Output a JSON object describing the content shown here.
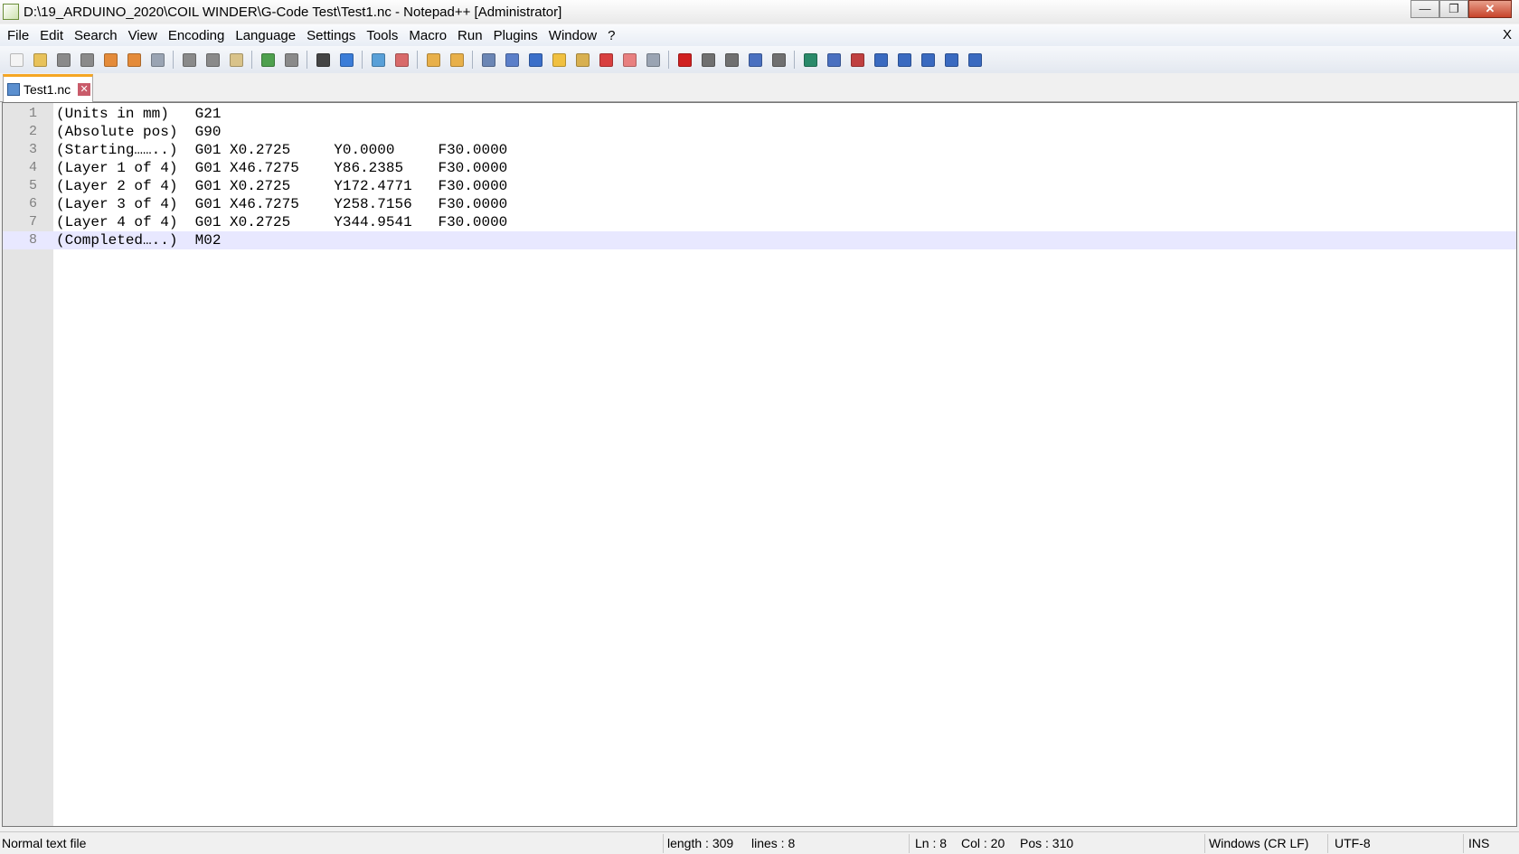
{
  "window": {
    "title": "D:\\19_ARDUINO_2020\\COIL WINDER\\G-Code Test\\Test1.nc - Notepad++ [Administrator]",
    "minimize": "—",
    "maximize": "❐",
    "close": "✕"
  },
  "menu": [
    "File",
    "Edit",
    "Search",
    "View",
    "Encoding",
    "Language",
    "Settings",
    "Tools",
    "Macro",
    "Run",
    "Plugins",
    "Window",
    "?"
  ],
  "menu_close": "X",
  "toolbar": [
    {
      "name": "new-file-icon",
      "color": "#f4f4f4"
    },
    {
      "name": "open-file-icon",
      "color": "#e8c25a"
    },
    {
      "name": "save-icon",
      "color": "#8a8a8a"
    },
    {
      "name": "save-all-icon",
      "color": "#8a8a8a"
    },
    {
      "name": "close-icon",
      "color": "#e48b3a"
    },
    {
      "name": "close-all-icon",
      "color": "#e48b3a"
    },
    {
      "name": "print-icon",
      "color": "#9aa4b3"
    },
    "sep",
    {
      "name": "cut-icon",
      "color": "#8a8a8a"
    },
    {
      "name": "copy-icon",
      "color": "#8a8a8a"
    },
    {
      "name": "paste-icon",
      "color": "#d9c38a"
    },
    "sep",
    {
      "name": "undo-icon",
      "color": "#4ea04e"
    },
    {
      "name": "redo-icon",
      "color": "#8a8a8a"
    },
    "sep",
    {
      "name": "find-icon",
      "color": "#444444"
    },
    {
      "name": "replace-icon",
      "color": "#3b7dd8"
    },
    "sep",
    {
      "name": "zoom-in-icon",
      "color": "#59a0d8"
    },
    {
      "name": "zoom-out-icon",
      "color": "#d86a6a"
    },
    "sep",
    {
      "name": "sync-vertical-icon",
      "color": "#e8b04a"
    },
    {
      "name": "sync-horizontal-icon",
      "color": "#e8b04a"
    },
    "sep",
    {
      "name": "word-wrap-icon",
      "color": "#6b86b5"
    },
    {
      "name": "show-all-chars-icon",
      "color": "#5b7fc9"
    },
    {
      "name": "indent-guide-icon",
      "color": "#3b6fc9"
    },
    {
      "name": "doc-map-icon",
      "color": "#f0c040"
    },
    {
      "name": "function-list-icon",
      "color": "#d8b050"
    },
    {
      "name": "folder-workspace-icon",
      "color": "#d84040"
    },
    {
      "name": "monitor-icon",
      "color": "#e88080"
    },
    {
      "name": "eye-icon",
      "color": "#9aa4b3"
    },
    "sep",
    {
      "name": "record-macro-icon",
      "color": "#d02020"
    },
    {
      "name": "stop-macro-icon",
      "color": "#707070"
    },
    {
      "name": "play-macro-icon",
      "color": "#707070"
    },
    {
      "name": "run-macro-multiple-icon",
      "color": "#4a70c0"
    },
    {
      "name": "save-macro-icon",
      "color": "#707070"
    },
    "sep",
    {
      "name": "compare-icon",
      "color": "#2a8a6a"
    },
    {
      "name": "compare-next-icon",
      "color": "#4a70c0"
    },
    {
      "name": "compare-clear-icon",
      "color": "#c04040"
    },
    {
      "name": "first-diff-icon",
      "color": "#3a6ac0"
    },
    {
      "name": "prev-diff-icon",
      "color": "#3a6ac0"
    },
    {
      "name": "next-diff-icon",
      "color": "#3a6ac0"
    },
    {
      "name": "last-diff-icon",
      "color": "#3a6ac0"
    },
    {
      "name": "compare-panel-icon",
      "color": "#3a6ac0"
    }
  ],
  "tab": {
    "label": "Test1.nc",
    "close": "✕"
  },
  "lines": [
    {
      "n": "1",
      "text": "(Units in mm)   G21"
    },
    {
      "n": "2",
      "text": "(Absolute pos)  G90"
    },
    {
      "n": "3",
      "text": "(Starting……..)  G01 X0.2725     Y0.0000     F30.0000"
    },
    {
      "n": "4",
      "text": "(Layer 1 of 4)  G01 X46.7275    Y86.2385    F30.0000"
    },
    {
      "n": "5",
      "text": "(Layer 2 of 4)  G01 X0.2725     Y172.4771   F30.0000"
    },
    {
      "n": "6",
      "text": "(Layer 3 of 4)  G01 X46.7275    Y258.7156   F30.0000"
    },
    {
      "n": "7",
      "text": "(Layer 4 of 4)  G01 X0.2725     Y344.9541   F30.0000"
    },
    {
      "n": "8",
      "text": "(Completed…..)  M02"
    }
  ],
  "status": {
    "type": "Normal text file",
    "length": "length : 309",
    "lines": "lines : 8",
    "ln": "Ln : 8",
    "col": "Col : 20",
    "pos": "Pos : 310",
    "eol": "Windows (CR LF)",
    "encoding": "UTF-8",
    "mode": "INS"
  }
}
